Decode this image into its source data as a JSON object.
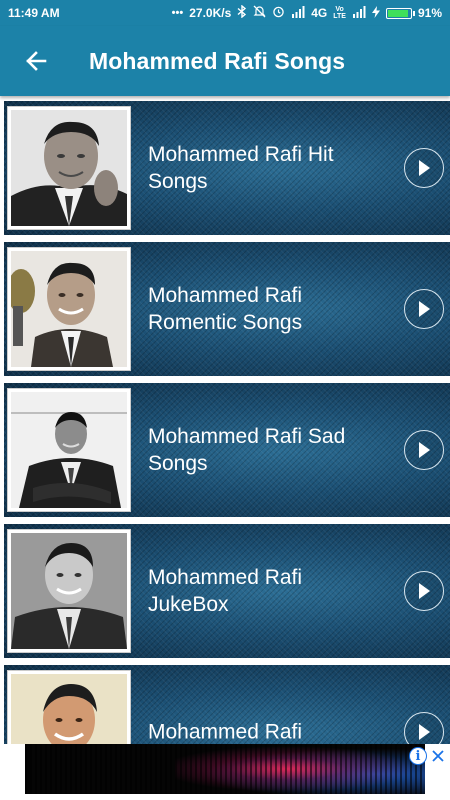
{
  "status_bar": {
    "time": "11:49 AM",
    "speed": "27.0K/s",
    "network": "4G",
    "battery_text": "91%",
    "battery_level": 0.91,
    "icons": [
      "more-dots-icon",
      "bluetooth-icon",
      "mute-icon",
      "alarm-icon",
      "signal-icon",
      "volte-icon",
      "charging-icon",
      "battery-icon"
    ]
  },
  "app_bar": {
    "title": "Mohammed Rafi Songs",
    "back_icon": "arrow-back-icon"
  },
  "list": {
    "items": [
      {
        "label": "Mohammed Rafi Hit Songs",
        "thumbnail": "portrait-photo"
      },
      {
        "label": "Mohammed Rafi Romentic Songs",
        "thumbnail": "portrait-photo"
      },
      {
        "label": "Mohammed Rafi Sad Songs",
        "thumbnail": "portrait-photo"
      },
      {
        "label": "Mohammed Rafi JukeBox",
        "thumbnail": "portrait-photo"
      },
      {
        "label": "Mohammed Rafi",
        "thumbnail": "portrait-photo"
      }
    ],
    "action_icon": "play-icon"
  },
  "ad": {
    "info_icon": "info-icon",
    "close_icon": "close-icon"
  },
  "colors": {
    "primary": "#1c82a8",
    "row_background": "#1b4f73",
    "text": "#ffffff"
  }
}
